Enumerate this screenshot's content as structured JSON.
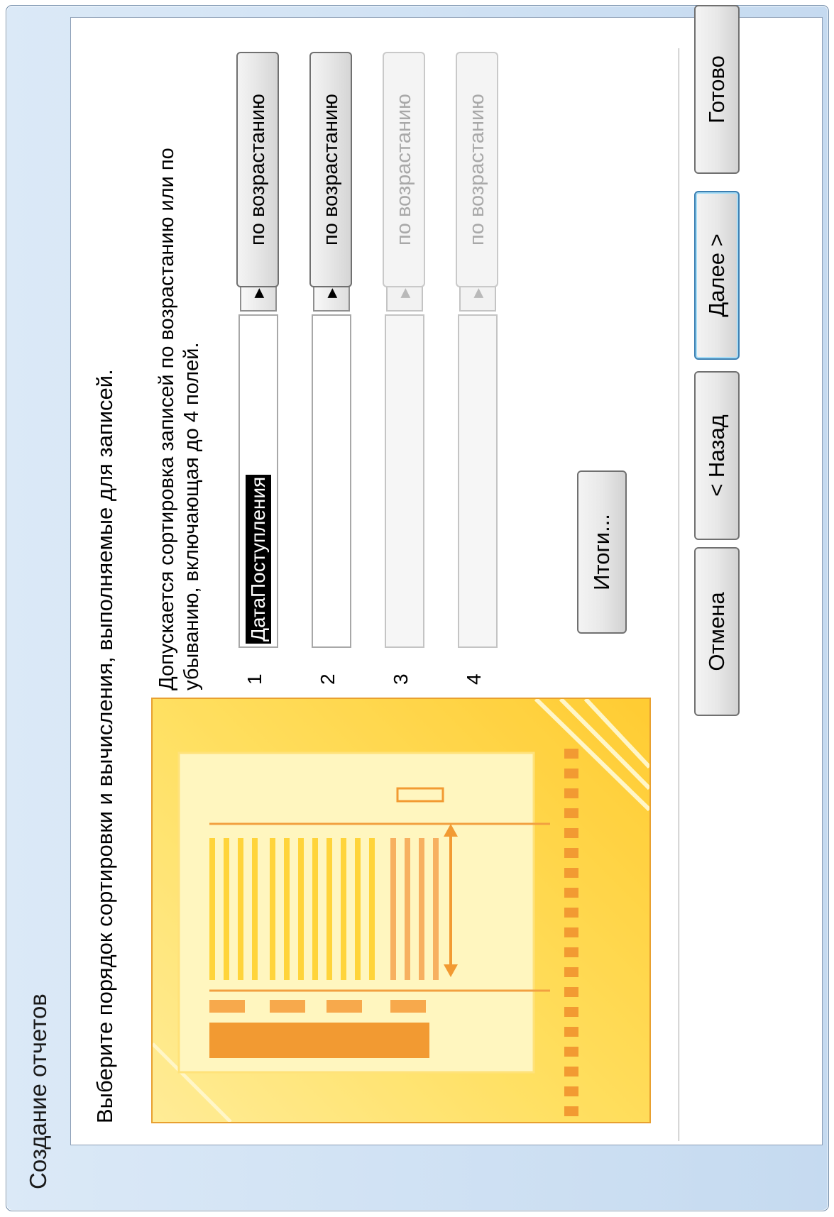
{
  "window": {
    "title": "Создание отчетов"
  },
  "instruction": "Выберите порядок сортировки и вычисления, выполняемые для записей.",
  "description_line1": "Допускается сортировка записей по возрастанию или по",
  "description_line2": "убыванию, включающая до 4 полей.",
  "sort_rows": [
    {
      "number": "1",
      "field_value": "ДатаПоступления",
      "order_label": "по возрастанию",
      "enabled": true
    },
    {
      "number": "2",
      "field_value": "",
      "order_label": "по возрастанию",
      "enabled": true
    },
    {
      "number": "3",
      "field_value": "",
      "order_label": "по возрастанию",
      "enabled": false
    },
    {
      "number": "4",
      "field_value": "",
      "order_label": "по возрастанию",
      "enabled": false
    }
  ],
  "dropdown_arrow": "▶",
  "totals_button": {
    "label": "Итоги..."
  },
  "footer": {
    "cancel": "Отмена",
    "back": "< Назад",
    "next": "Далее >",
    "finish": "Готово"
  },
  "colors": {
    "window_frame": "#c5daf0",
    "illustration_border": "#e8a030",
    "illustration_accent": "#f29a32",
    "default_button_border": "#3c7fb1",
    "selection_bg": "#000000"
  },
  "icons": {
    "dropdown": "dropdown-arrow-icon"
  }
}
